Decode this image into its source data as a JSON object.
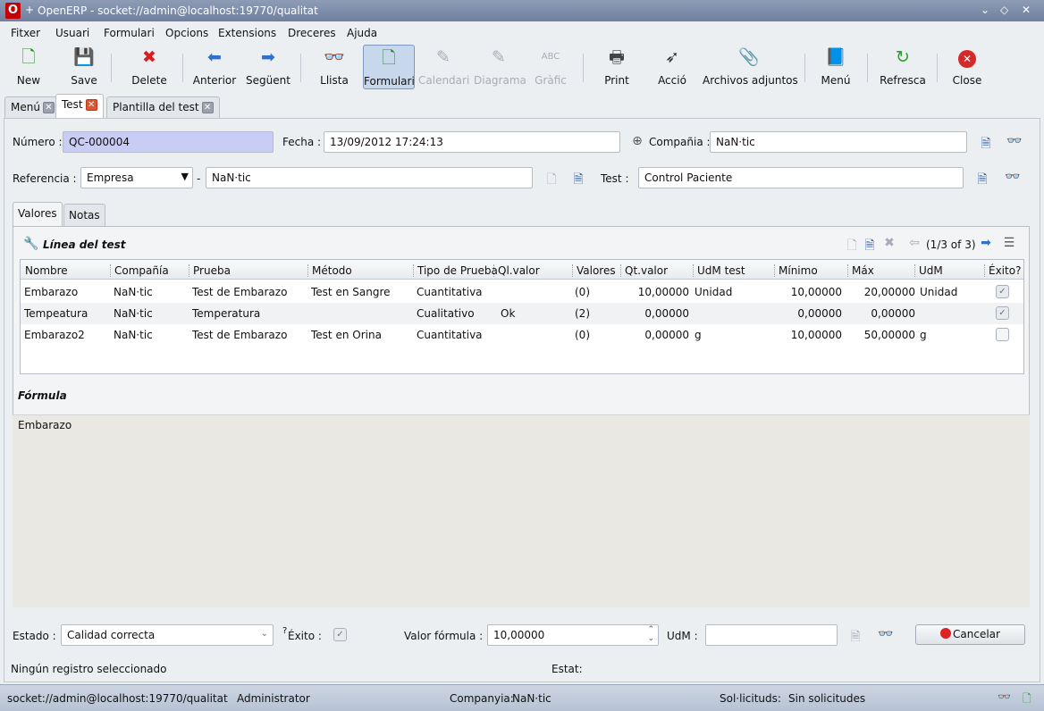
{
  "window": {
    "logo": "O",
    "plus": "+",
    "title": "OpenERP - socket://admin@localhost:19770/qualitat",
    "controls": [
      "⌄",
      "◇",
      "✕"
    ]
  },
  "menubar": [
    "Fitxer",
    "Usuari",
    "Formulari",
    "Opcions",
    "Extensions",
    "Dreceres",
    "Ajuda"
  ],
  "toolbar": {
    "new": "New",
    "save": "Save",
    "delete": "Delete",
    "previous": "Anterior",
    "next": "Següent",
    "list": "Llista",
    "form": "Formulari",
    "calendar": "Calendari",
    "diagram": "Diagrama",
    "graph": "Gràfic",
    "print": "Print",
    "action": "Acció",
    "attachments": "Archivos adjuntos",
    "menu": "Menú",
    "refresh": "Refresca",
    "close": "Close"
  },
  "doc_tabs": [
    "Menú",
    "Test",
    "Plantilla del test"
  ],
  "form": {
    "numero_label": "Número :",
    "numero_value": "QC-000004",
    "fecha_label": "Fecha :",
    "fecha_value": "13/09/2012 17:24:13",
    "compania_label": "Compañia :",
    "compania_value": "NaN·tic",
    "referencia_label": "Referencia :",
    "referencia_type": "Empresa",
    "referencia_dash": "-",
    "referencia_value": "NaN·tic",
    "test_label": "Test :",
    "test_value": "Control Paciente"
  },
  "notebook": {
    "tabs": [
      "Valores",
      "Notas"
    ],
    "section_title": "Línea del test",
    "pager": "(1/3 of 3)",
    "formula_title": "Fórmula",
    "formula_text": "Embarazo"
  },
  "grid": {
    "columns": [
      "Nombre",
      "Compañía",
      "Prueba",
      "Método",
      "Tipo de Prueba",
      "Ql.valor",
      "Valores",
      "Qt.valor",
      "UdM test",
      "Mínimo",
      "Máx",
      "UdM",
      "Éxito?"
    ],
    "rows": [
      {
        "nombre": "Embarazo",
        "compania": "NaN·tic",
        "prueba": "Test de Embarazo",
        "metodo": "Test en Sangre",
        "tipo": "Cuantitativa",
        "qlvalor": "",
        "valores": "(0)",
        "qtvalor": "10,00000",
        "udmtest": "Unidad",
        "minimo": "10,00000",
        "max": "20,00000",
        "udm": "Unidad",
        "exito": "✓"
      },
      {
        "nombre": "Tempeatura",
        "compania": "NaN·tic",
        "prueba": "Temperatura",
        "metodo": "",
        "tipo": "Cualitativo",
        "qlvalor": "Ok",
        "valores": "(2)",
        "qtvalor": "0,00000",
        "udmtest": "",
        "minimo": "0,00000",
        "max": "0,00000",
        "udm": "",
        "exito": "✓"
      },
      {
        "nombre": "Embarazo2",
        "compania": "NaN·tic",
        "prueba": "Test de Embarazo",
        "metodo": "Test en Orina",
        "tipo": "Cuantitativa",
        "qlvalor": "",
        "valores": "(0)",
        "qtvalor": "0,00000",
        "udmtest": "g",
        "minimo": "10,00000",
        "max": "50,00000",
        "udm": "g",
        "exito": ""
      }
    ]
  },
  "bottom": {
    "estado_label": "Estado :",
    "estado_value": "Calidad correcta",
    "exito_label": "Éxito :",
    "exito_prefix": "?",
    "valor_formula_label": "Valor fórmula :",
    "valor_formula_value": "10,00000",
    "udm_label": "UdM :",
    "udm_value": "",
    "cancel_label": "Cancelar",
    "no_selection": "Ningún registro seleccionado",
    "estat_label": "Estat:"
  },
  "statusbar": {
    "connection": "socket://admin@localhost:19770/qualitat",
    "user": "Administrator",
    "company_label": "Companyia:",
    "company_value": "NaN·tic",
    "requests_label": "Sol·licituds:",
    "requests_value": "Sin solicitudes"
  },
  "colors": {
    "required_field": "#c9ccf4",
    "titlebar": "#7f8ea9",
    "statusbar": "#c2ccdb"
  }
}
